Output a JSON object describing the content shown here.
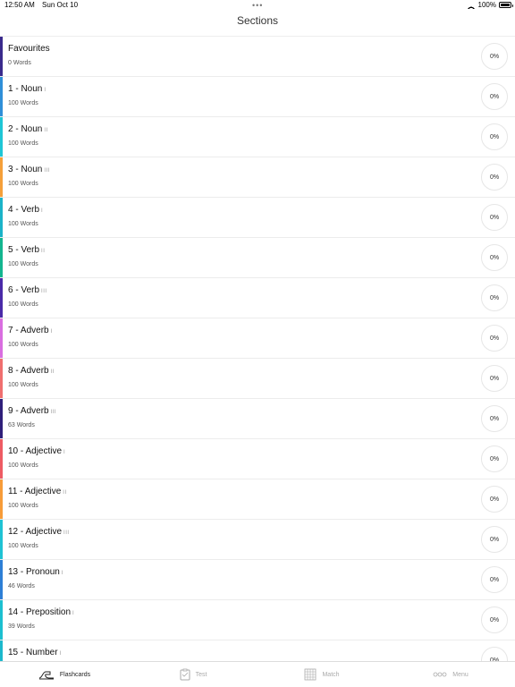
{
  "status_bar": {
    "time": "12:50 AM",
    "date": "Sun Oct 10",
    "battery": "100%",
    "battery_level": 1.0,
    "dots": "•••"
  },
  "nav": {
    "title": "Sections"
  },
  "sections": [
    {
      "title": "Favourites",
      "level": "",
      "count": "0 Words",
      "progress": "0%",
      "color": "#3a2a8c"
    },
    {
      "title": "1 - Noun",
      "level": "I",
      "count": "100 Words",
      "progress": "0%",
      "color": "#2f8fd8"
    },
    {
      "title": "2 - Noun",
      "level": "II",
      "count": "100 Words",
      "progress": "0%",
      "color": "#1fc6d6"
    },
    {
      "title": "3 - Noun",
      "level": "III",
      "count": "100 Words",
      "progress": "0%",
      "color": "#f5a03a"
    },
    {
      "title": "4 - Verb",
      "level": "I",
      "count": "100 Words",
      "progress": "0%",
      "color": "#1bb3c8"
    },
    {
      "title": "5 - Verb",
      "level": "II",
      "count": "100 Words",
      "progress": "0%",
      "color": "#13b58f"
    },
    {
      "title": "6 - Verb",
      "level": "III",
      "count": "100 Words",
      "progress": "0%",
      "color": "#4a2aa8"
    },
    {
      "title": "7 - Adverb",
      "level": "I",
      "count": "100 Words",
      "progress": "0%",
      "color": "#d96ee0"
    },
    {
      "title": "8 - Adverb",
      "level": "II",
      "count": "100 Words",
      "progress": "0%",
      "color": "#f06f6f"
    },
    {
      "title": "9 - Adverb",
      "level": "III",
      "count": "63 Words",
      "progress": "0%",
      "color": "#2f1f7a"
    },
    {
      "title": "10 - Adjective",
      "level": "I",
      "count": "100 Words",
      "progress": "0%",
      "color": "#ee5b63"
    },
    {
      "title": "11 - Adjective",
      "level": "II",
      "count": "100 Words",
      "progress": "0%",
      "color": "#f79c39"
    },
    {
      "title": "12 - Adjective",
      "level": "III",
      "count": "100 Words",
      "progress": "0%",
      "color": "#1fc2d4"
    },
    {
      "title": "13 - Pronoun",
      "level": "I",
      "count": "46 Words",
      "progress": "0%",
      "color": "#2d7fd6"
    },
    {
      "title": "14 - Preposition",
      "level": "I",
      "count": "39 Words",
      "progress": "0%",
      "color": "#1cbfd0"
    },
    {
      "title": "15 - Number",
      "level": "I",
      "count": "",
      "progress": "0%",
      "color": "#1cb8cc"
    }
  ],
  "tabs": [
    {
      "label": "Flashcards",
      "icon": "flashcards-icon",
      "active": true
    },
    {
      "label": "Test",
      "icon": "test-icon",
      "active": false
    },
    {
      "label": "Match",
      "icon": "match-icon",
      "active": false
    },
    {
      "label": "Menu",
      "icon": "menu-icon",
      "active": false
    }
  ]
}
